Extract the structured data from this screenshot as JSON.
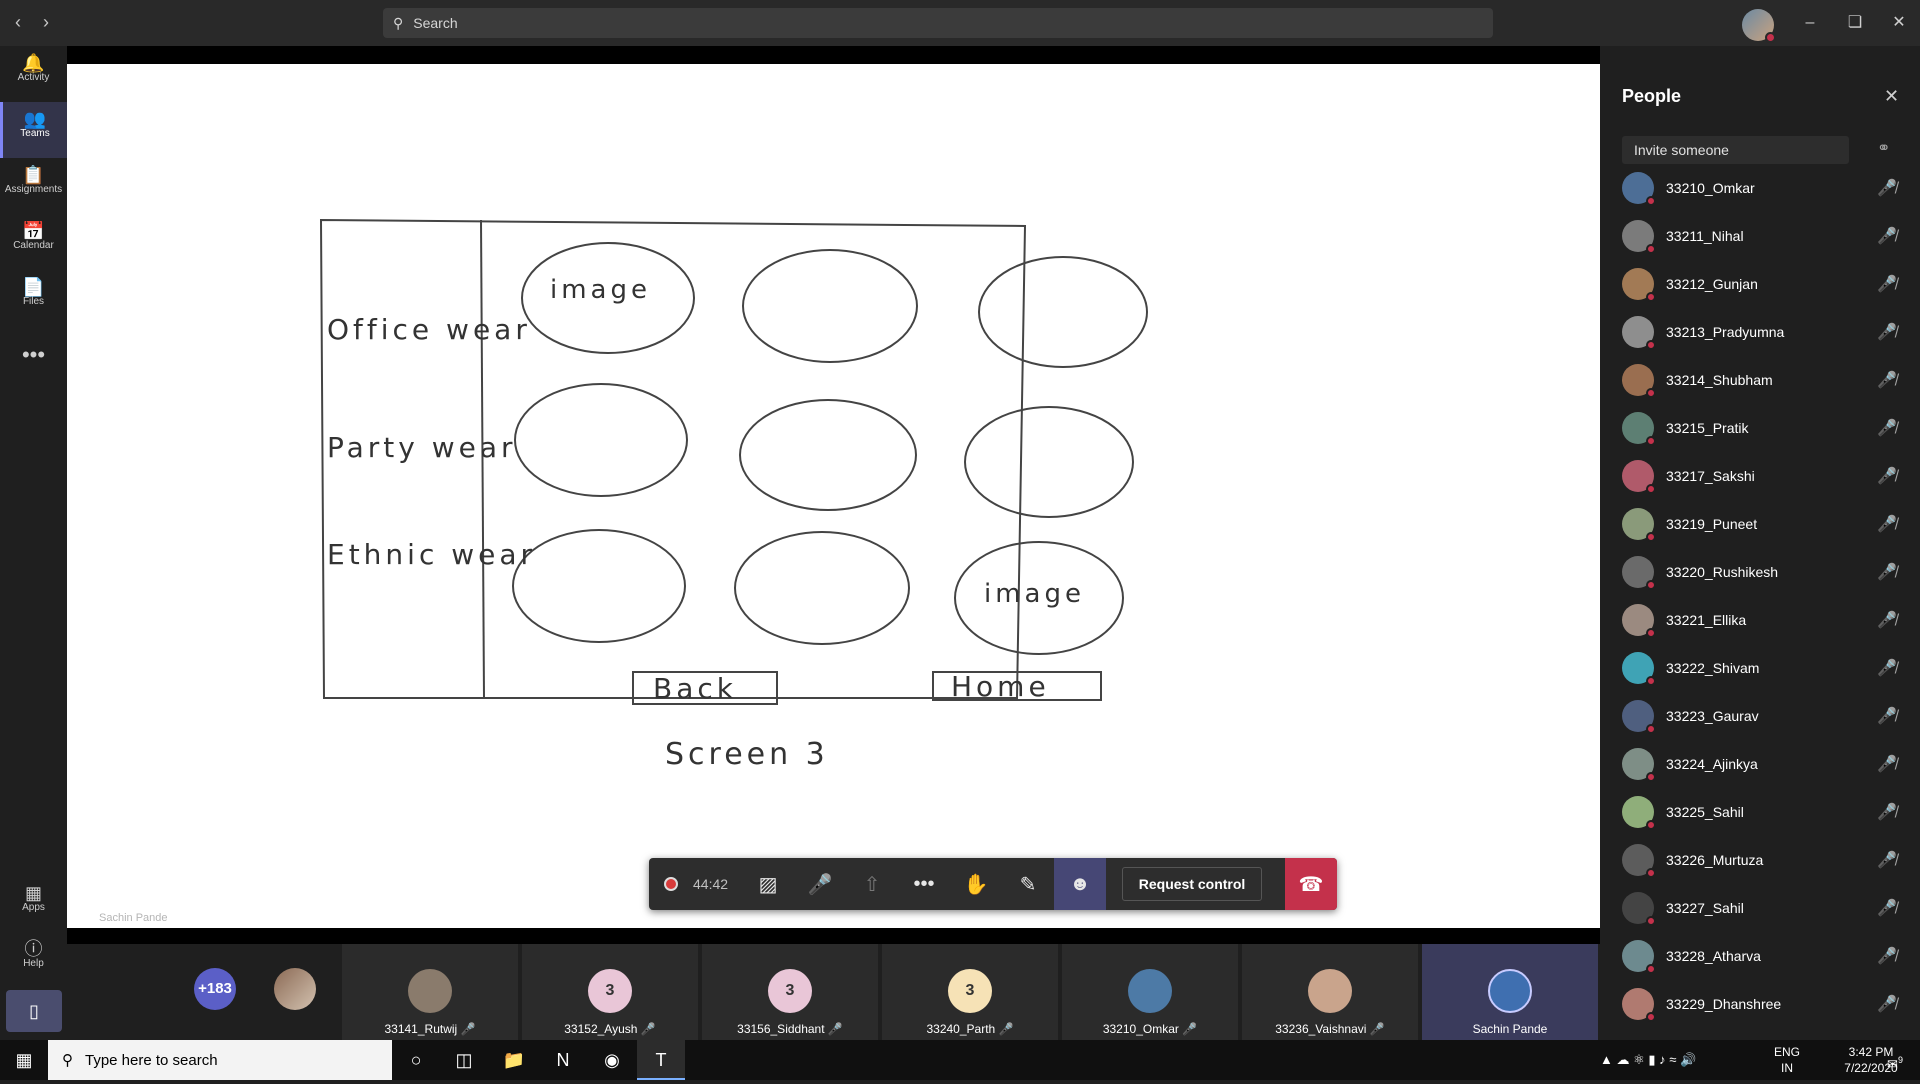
{
  "titlebar": {
    "search_placeholder": "Search",
    "back": "‹",
    "forward": "›"
  },
  "rail": {
    "items": [
      {
        "label": "Activity",
        "icon": "🔔"
      },
      {
        "label": "Teams",
        "icon": "👥"
      },
      {
        "label": "Assignments",
        "icon": "📋"
      },
      {
        "label": "Calendar",
        "icon": "📅"
      },
      {
        "label": "Files",
        "icon": "📄"
      }
    ],
    "more": "•••",
    "apps": "Apps",
    "help": "Help"
  },
  "shared_screen": {
    "row_labels": [
      "Office wear",
      "Party wear",
      "Ethnic wear"
    ],
    "image_label_1": "image",
    "image_label_2": "image",
    "back_button": "Back",
    "home_button": "Home",
    "caption": "Screen 3",
    "presenter": "Sachin Pande"
  },
  "controls": {
    "timer": "44:42",
    "request_control": "Request control"
  },
  "strip": {
    "overflow": "+183",
    "tiles": [
      {
        "name": "33141_Rutwij",
        "initials": "",
        "bg": "#8a7b6c"
      },
      {
        "name": "33152_Ayush",
        "initials": "3",
        "bg": "#e9c6d7"
      },
      {
        "name": "33156_Siddhant",
        "initials": "3",
        "bg": "#e9c6d7"
      },
      {
        "name": "33240_Parth",
        "initials": "3",
        "bg": "#f6e2b6"
      },
      {
        "name": "33210_Omkar",
        "initials": "",
        "bg": "#4d7aa6"
      },
      {
        "name": "33236_Vaishnavi",
        "initials": "",
        "bg": "#c9a48c"
      },
      {
        "name": "Sachin Pande",
        "initials": "",
        "bg": "#3f6fb0"
      }
    ]
  },
  "people": {
    "title": "People",
    "invite_placeholder": "Invite someone",
    "participants": [
      {
        "name": "33210_Omkar",
        "bg": "#4d6e96"
      },
      {
        "name": "33211_Nihal",
        "bg": "#7b7b7b"
      },
      {
        "name": "33212_Gunjan",
        "bg": "#a27a55"
      },
      {
        "name": "33213_Pradyumna",
        "bg": "#8e8e8e"
      },
      {
        "name": "33214_Shubham",
        "bg": "#9a6e50"
      },
      {
        "name": "33215_Pratik",
        "bg": "#5d7f73"
      },
      {
        "name": "33217_Sakshi",
        "bg": "#b05a6a"
      },
      {
        "name": "33219_Puneet",
        "bg": "#8a9a7a"
      },
      {
        "name": "33220_Rushikesh",
        "bg": "#6a6a6a"
      },
      {
        "name": "33221_Ellika",
        "bg": "#9b8a80"
      },
      {
        "name": "33222_Shivam",
        "bg": "#3fa3b5"
      },
      {
        "name": "33223_Gaurav",
        "bg": "#4f5f7f"
      },
      {
        "name": "33224_Ajinkya",
        "bg": "#7e8e86"
      },
      {
        "name": "33225_Sahil",
        "bg": "#8fae7a"
      },
      {
        "name": "33226_Murtuza",
        "bg": "#5c5c5c"
      },
      {
        "name": "33227_Sahil",
        "bg": "#444444"
      },
      {
        "name": "33228_Atharva",
        "bg": "#6d8a8f"
      },
      {
        "name": "33229_Dhanshree",
        "bg": "#b07a70"
      }
    ]
  },
  "taskbar": {
    "search_placeholder": "Type here to search",
    "lang_1": "ENG",
    "lang_2": "IN",
    "time": "3:42 PM",
    "date": "7/22/2020",
    "notifications": "9"
  }
}
